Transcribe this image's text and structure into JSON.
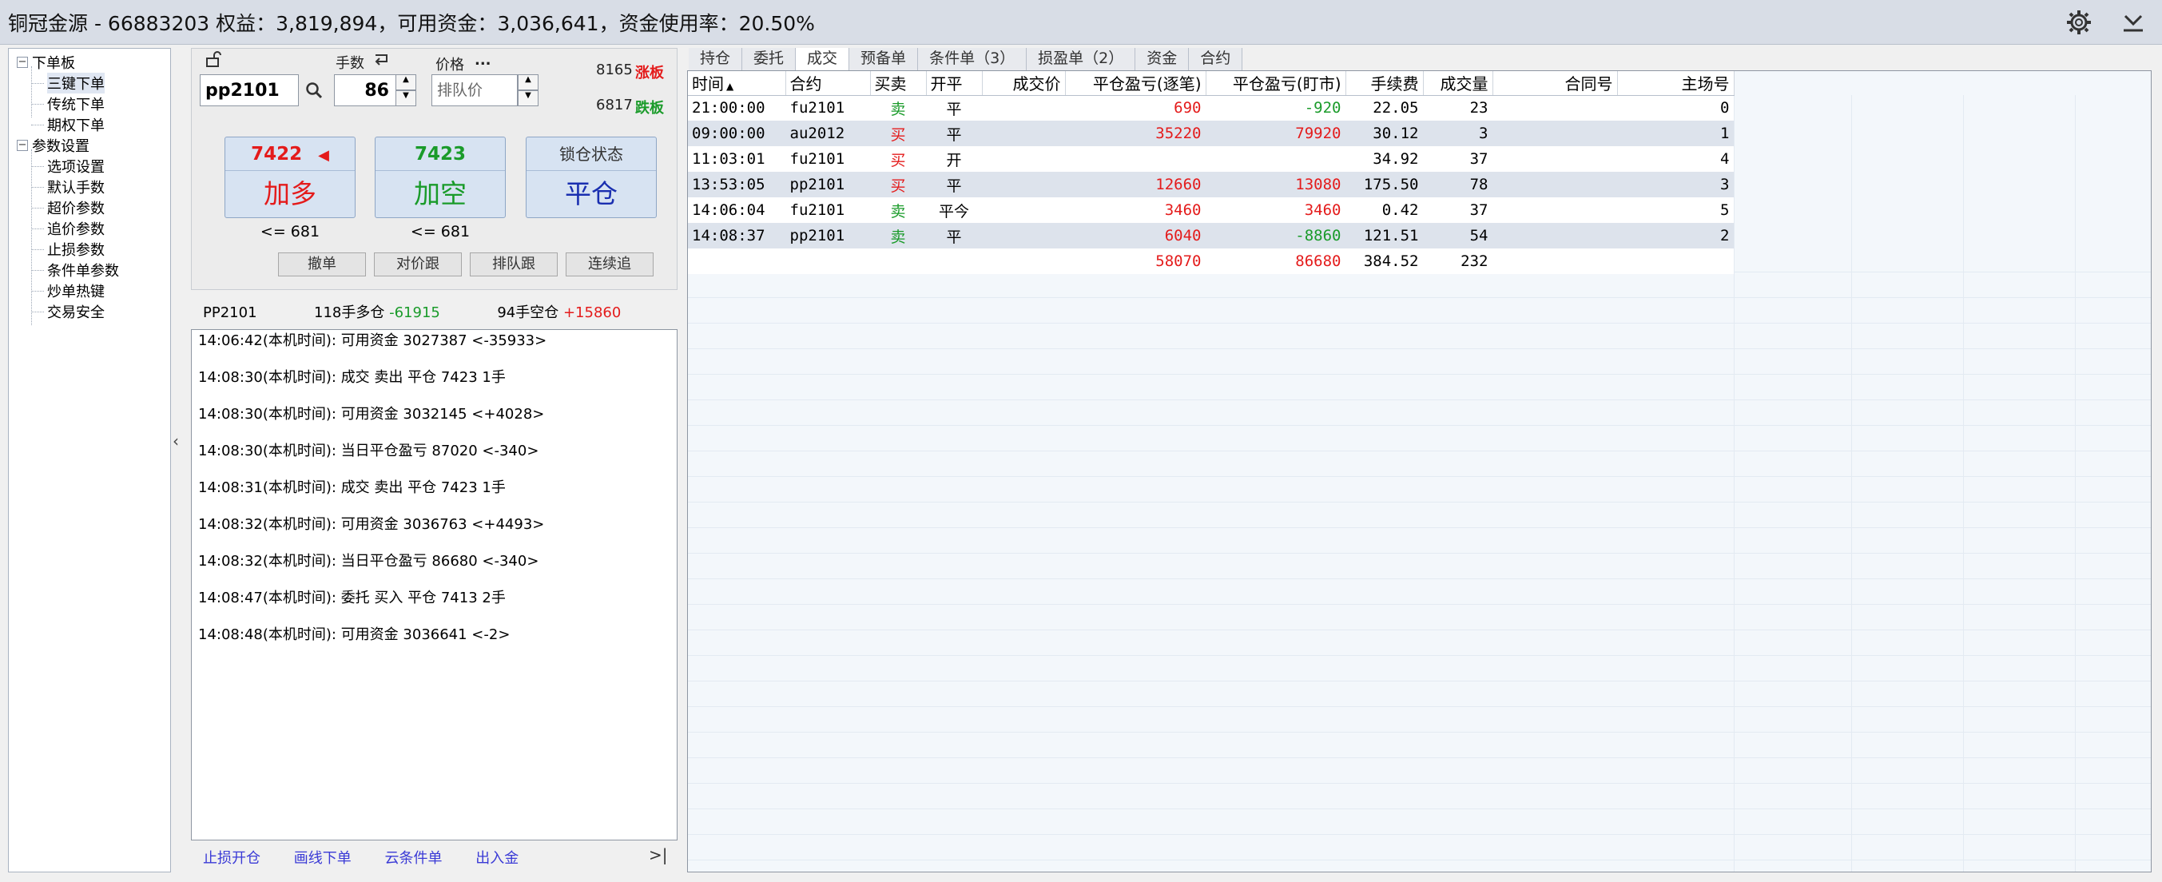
{
  "titlebar": {
    "title": "铜冠金源 - 66883203  权益：3,819,894，可用资金：3,036,641，资金使用率：20.50%"
  },
  "tree": {
    "groups": [
      {
        "label": "下单板",
        "items": [
          "三键下单",
          "传统下单",
          "期权下单"
        ]
      },
      {
        "label": "参数设置",
        "items": [
          "选项设置",
          "默认手数",
          "超价参数",
          "追价参数",
          "止损参数",
          "条件单参数",
          "炒单热键",
          "交易安全"
        ]
      }
    ]
  },
  "order": {
    "qty_label": "手数",
    "price_label": "价格",
    "price_ellipsis": "...",
    "symbol": "pp2101",
    "qty": "86",
    "price_placeholder": "排队价",
    "limit_up_value": "8165",
    "limit_up_label": "涨板",
    "limit_down_value": "6817",
    "limit_down_label": "跌板",
    "buy": {
      "price": "7422",
      "action": "加多",
      "under": "<= 681"
    },
    "sell": {
      "price": "7423",
      "action": "加空",
      "under": "<= 681"
    },
    "lock": {
      "status": "锁仓状态",
      "action": "平仓"
    },
    "buttons": [
      "撤单",
      "对价跟",
      "排队跟",
      "连续追"
    ]
  },
  "position": {
    "symbol": "PP2101",
    "long_qty": "118",
    "long_label": "手多仓",
    "long_pnl": "-61915",
    "short_qty": "94",
    "short_label": "手空仓",
    "short_pnl": "+15860"
  },
  "log": [
    {
      "time": "14:06:42",
      "tag": "(本机时间): ",
      "msg": "可用资金 3027387 <-35933>"
    },
    {
      "time": "14:08:30",
      "tag": "(本机时间): ",
      "msg": "成交 卖出 平仓 7423 1手"
    },
    {
      "time": "14:08:30",
      "tag": "(本机时间): ",
      "msg": "可用资金 3032145 <+4028>"
    },
    {
      "time": "14:08:30",
      "tag": "(本机时间): ",
      "msg": "当日平仓盈亏 87020 <-340>"
    },
    {
      "time": "14:08:31",
      "tag": "(本机时间): ",
      "msg": "成交 卖出 平仓 7423 1手"
    },
    {
      "time": "14:08:32",
      "tag": "(本机时间): ",
      "msg": "可用资金 3036763 <+4493>"
    },
    {
      "time": "14:08:32",
      "tag": "(本机时间): ",
      "msg": "当日平仓盈亏 86680 <-340>"
    },
    {
      "time": "14:08:47",
      "tag": "(本机时间): ",
      "msg": "委托 买入 平仓 7413 2手"
    },
    {
      "time": "14:08:48",
      "tag": "(本机时间): ",
      "msg": "可用资金 3036641 <-2>"
    }
  ],
  "bottom_links": [
    "止损开仓",
    "画线下单",
    "云条件单",
    "出入金"
  ],
  "bottom_end": ">|",
  "splitter": "‹",
  "tabs": [
    "持仓",
    "委托",
    "成交",
    "预备单",
    "条件单（3）",
    "损盈单（2）",
    "资金",
    "合约"
  ],
  "active_tab": "成交",
  "columns": [
    "时间",
    "合约",
    "买卖",
    "开平",
    "成交价",
    "平仓盈亏(逐笔)",
    "平仓盈亏(盯市)",
    "手续费",
    "成交量",
    "合同号",
    "主场号"
  ],
  "sort_indicator": "▲",
  "rows": [
    {
      "time": "21:00:00",
      "contract": "fu2101",
      "side": "卖",
      "oc": "平",
      "price": "",
      "pnl_trade": "690",
      "pnl_mtm": "-920",
      "fee": "22.05",
      "vol": "23",
      "order_no": "",
      "seq": "0"
    },
    {
      "time": "09:00:00",
      "contract": "au2012",
      "side": "买",
      "oc": "平",
      "price": "",
      "pnl_trade": "35220",
      "pnl_mtm": "79920",
      "fee": "30.12",
      "vol": "3",
      "order_no": "",
      "seq": "1"
    },
    {
      "time": "11:03:01",
      "contract": "fu2101",
      "side": "买",
      "oc": "开",
      "price": "",
      "pnl_trade": "",
      "pnl_mtm": "",
      "fee": "34.92",
      "vol": "37",
      "order_no": "",
      "seq": "4"
    },
    {
      "time": "13:53:05",
      "contract": "pp2101",
      "side": "买",
      "oc": "平",
      "price": "",
      "pnl_trade": "12660",
      "pnl_mtm": "13080",
      "fee": "175.50",
      "vol": "78",
      "order_no": "",
      "seq": "3"
    },
    {
      "time": "14:06:04",
      "contract": "fu2101",
      "side": "卖",
      "oc": "平今",
      "price": "",
      "pnl_trade": "3460",
      "pnl_mtm": "3460",
      "fee": "0.42",
      "vol": "37",
      "order_no": "",
      "seq": "5"
    },
    {
      "time": "14:08:37",
      "contract": "pp2101",
      "side": "卖",
      "oc": "平",
      "price": "",
      "pnl_trade": "6040",
      "pnl_mtm": "-8860",
      "fee": "121.51",
      "vol": "54",
      "order_no": "",
      "seq": "2"
    }
  ],
  "totals": {
    "pnl_trade": "58070",
    "pnl_mtm": "86680",
    "fee": "384.52",
    "vol": "232"
  },
  "colors": {
    "buy": "#e41b1b",
    "sell": "#1a9b2a",
    "accent": "#1a2fb0",
    "link": "#3a3ad6"
  }
}
